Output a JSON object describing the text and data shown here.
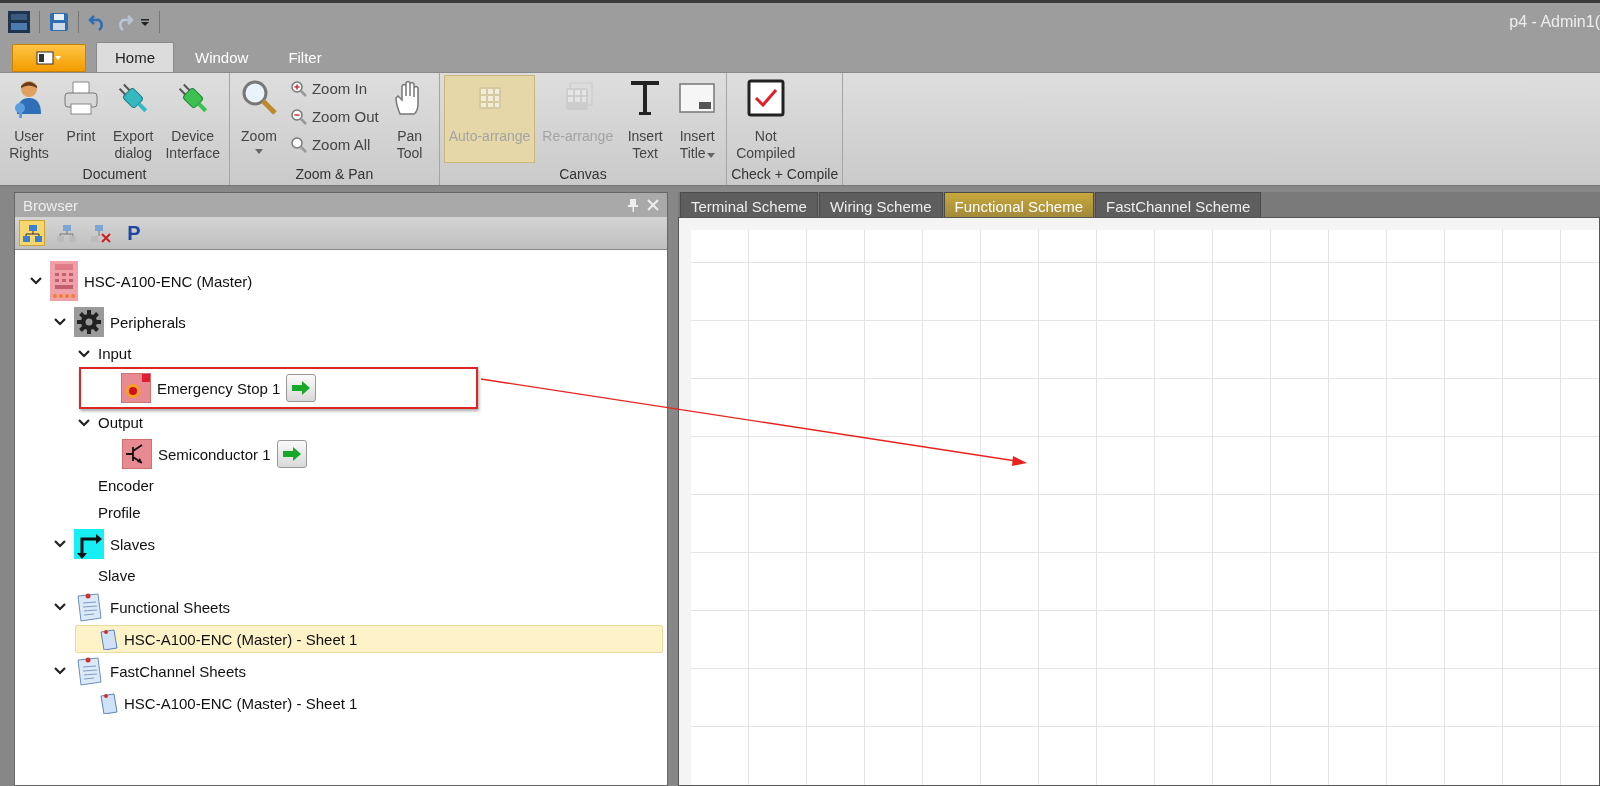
{
  "window": {
    "title": "p4 - Admin1("
  },
  "ribbon_tabs": [
    {
      "label": "Home",
      "selected": true
    },
    {
      "label": "Window",
      "selected": false
    },
    {
      "label": "Filter",
      "selected": false
    }
  ],
  "ribbon_groups": [
    {
      "title": "Document",
      "buttons": [
        {
          "label": "User\nRights",
          "kind": "large",
          "disabled": false,
          "checked": false,
          "dropdown": false
        },
        {
          "label": "Print",
          "kind": "large",
          "disabled": false,
          "checked": false,
          "dropdown": false
        },
        {
          "label": "Export\ndialog",
          "kind": "large",
          "disabled": false,
          "checked": false,
          "dropdown": false
        },
        {
          "label": "Device\nInterface",
          "kind": "large",
          "disabled": false,
          "checked": false,
          "dropdown": false
        }
      ]
    },
    {
      "title": "Zoom & Pan",
      "buttons": [
        {
          "label": "Zoom",
          "kind": "large",
          "disabled": false,
          "checked": false,
          "dropdown": true
        },
        {
          "label": "Zoom In",
          "kind": "small",
          "disabled": false,
          "checked": false,
          "dropdown": false
        },
        {
          "label": "Zoom Out",
          "kind": "small",
          "disabled": false,
          "checked": false,
          "dropdown": false
        },
        {
          "label": "Zoom All",
          "kind": "small",
          "disabled": false,
          "checked": false,
          "dropdown": false
        },
        {
          "label": "Pan\nTool",
          "kind": "large",
          "disabled": false,
          "checked": false,
          "dropdown": false
        }
      ]
    },
    {
      "title": "Canvas",
      "buttons": [
        {
          "label": "Auto-arrange",
          "kind": "large",
          "disabled": true,
          "checked": true,
          "dropdown": false
        },
        {
          "label": "Re-arrange",
          "kind": "large",
          "disabled": true,
          "checked": false,
          "dropdown": false
        },
        {
          "label": "Insert\nText",
          "kind": "large",
          "disabled": false,
          "checked": false,
          "dropdown": false
        },
        {
          "label": "Insert\nTitle",
          "kind": "large",
          "disabled": false,
          "checked": false,
          "dropdown": true
        }
      ]
    },
    {
      "title": "Check + Compile",
      "buttons": [
        {
          "label": "Not\nCompiled",
          "kind": "large",
          "disabled": false,
          "checked": false,
          "dropdown": false
        }
      ]
    }
  ],
  "browser": {
    "title": "Browser",
    "toolbar": [
      {
        "selected": true
      },
      {
        "selected": false
      },
      {
        "selected": false
      },
      {
        "label": "P",
        "selected": false
      }
    ],
    "tree": [
      {
        "label": "HSC-A100-ENC (Master)",
        "kind": "device",
        "selected": false,
        "expanded": true,
        "children": [
          {
            "label": "Peripherals",
            "kind": "peripherals",
            "selected": false,
            "expanded": true,
            "children": [
              {
                "label": "Input",
                "kind": "folder",
                "selected": false,
                "expanded": true,
                "children": [
                  {
                    "label": "Emergency Stop 1",
                    "kind": "stop",
                    "selected": false,
                    "annotated": true,
                    "go": true
                  }
                ]
              },
              {
                "label": "Output",
                "kind": "folder",
                "selected": false,
                "expanded": true,
                "children": [
                  {
                    "label": "Semiconductor 1",
                    "kind": "semiconductor",
                    "selected": false,
                    "annotated": false,
                    "go": true
                  }
                ]
              },
              {
                "label": "Encoder",
                "kind": "folder",
                "selected": false
              },
              {
                "label": "Profile",
                "kind": "folder",
                "selected": false
              }
            ]
          },
          {
            "label": "Slaves",
            "kind": "slaves",
            "selected": false,
            "expanded": true,
            "children": [
              {
                "label": "Slave",
                "kind": "folder",
                "selected": false
              }
            ]
          },
          {
            "label": "Functional Sheets",
            "kind": "sheets",
            "selected": false,
            "expanded": true,
            "children": [
              {
                "label": "HSC-A100-ENC (Master) - Sheet 1",
                "kind": "sheet",
                "selected": true
              }
            ]
          },
          {
            "label": "FastChannel Sheets",
            "kind": "sheets",
            "selected": false,
            "expanded": true,
            "children": [
              {
                "label": "HSC-A100-ENC (Master) - Sheet 1",
                "kind": "sheet",
                "selected": false
              }
            ]
          }
        ]
      }
    ]
  },
  "document_tabs": [
    {
      "label": "Terminal Scheme",
      "selected": false
    },
    {
      "label": "Wiring Scheme",
      "selected": false
    },
    {
      "label": "Functional Scheme",
      "selected": true
    },
    {
      "label": "FastChannel Scheme",
      "selected": false
    }
  ]
}
